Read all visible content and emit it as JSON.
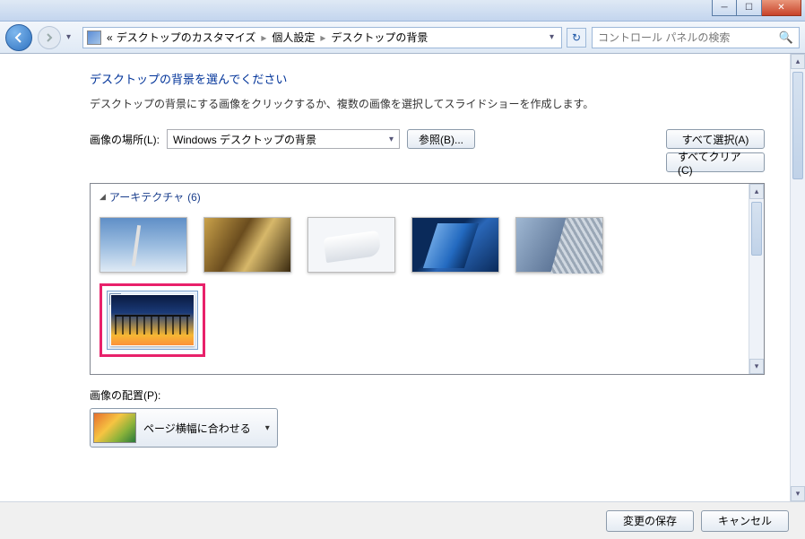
{
  "breadcrumb": {
    "prefix": "«",
    "items": [
      "デスクトップのカスタマイズ",
      "個人設定",
      "デスクトップの背景"
    ]
  },
  "search": {
    "placeholder": "コントロール パネルの検索"
  },
  "page": {
    "title": "デスクトップの背景を選んでください",
    "desc": "デスクトップの背景にする画像をクリックするか、複数の画像を選択してスライドショーを作成します。"
  },
  "location": {
    "label": "画像の場所(L):",
    "value": "Windows デスクトップの背景",
    "browse": "参照(B)..."
  },
  "select_buttons": {
    "select_all": "すべて選択(A)",
    "clear_all": "すべてクリア(C)"
  },
  "group": {
    "name": "アーキテクチャ",
    "count": "(6)"
  },
  "position": {
    "label": "画像の配置(P):",
    "value": "ページ横幅に合わせる"
  },
  "footer": {
    "save": "変更の保存",
    "cancel": "キャンセル"
  }
}
